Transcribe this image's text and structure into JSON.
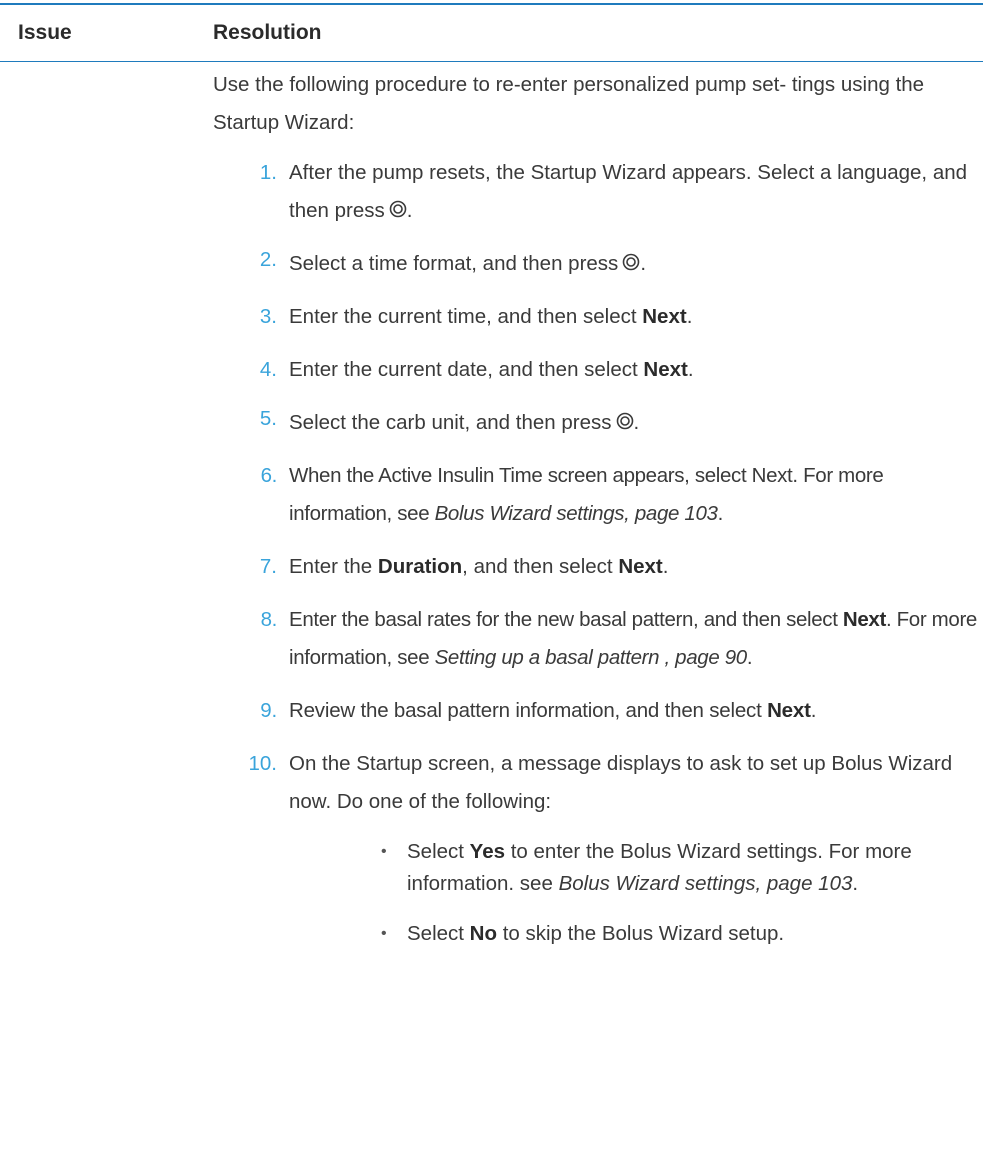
{
  "table": {
    "headers": {
      "issue": "Issue",
      "resolution": "Resolution"
    }
  },
  "intro": "Use the following procedure to re-enter personalized pump set- tings using the Startup Wizard:",
  "steps": [
    {
      "num": "1.",
      "text": "After the pump resets, the Startup Wizard appears. Select a language, and then press"
    },
    {
      "num": "2.",
      "text": "Select a time format, and then press"
    },
    {
      "num": "3.",
      "pre": "Enter the current time, and then select ",
      "bold": "Next",
      "post": "."
    },
    {
      "num": "4.",
      "pre": "Enter the current date, and then select ",
      "bold": "Next",
      "post": "."
    },
    {
      "num": "5.",
      "text": "Select the carb unit, and then press"
    },
    {
      "num": "6.",
      "pre": "When the Active Insulin Time screen appears, select Next. For more information, see ",
      "italic": "Bolus Wizard settings, page 103",
      "post": "."
    },
    {
      "num": "7.",
      "pre": "Enter the ",
      "bold": "Duration",
      "mid": ", and then select ",
      "bold2": "Next",
      "post": "."
    },
    {
      "num": "8.",
      "pre": "Enter the basal rates for the new basal pattern, and then select ",
      "bold": "Next",
      "mid": ". For more information, see ",
      "italic": "Setting up a basal pattern , page 90",
      "post": "."
    },
    {
      "num": "9.",
      "pre": "Review the basal pattern information, and then select ",
      "bold": "Next",
      "post": "."
    },
    {
      "num": "10.",
      "text": "On the Startup screen, a message displays to ask to set up Bolus Wizard now. Do one of the following:"
    }
  ],
  "bullets": [
    {
      "dot": "•",
      "pre": "Select ",
      "bold": "Yes",
      "mid": " to enter the Bolus Wizard settings. For more information. see ",
      "italic": "Bolus Wizard settings, page 103",
      "post": "."
    },
    {
      "dot": "•",
      "pre": "Select ",
      "bold": "No",
      "post": " to skip the Bolus Wizard setup."
    }
  ],
  "icons": {
    "press": "select-button-icon"
  },
  "colors": {
    "accent": "#1f7bbd",
    "step_number": "#3aa4db"
  }
}
